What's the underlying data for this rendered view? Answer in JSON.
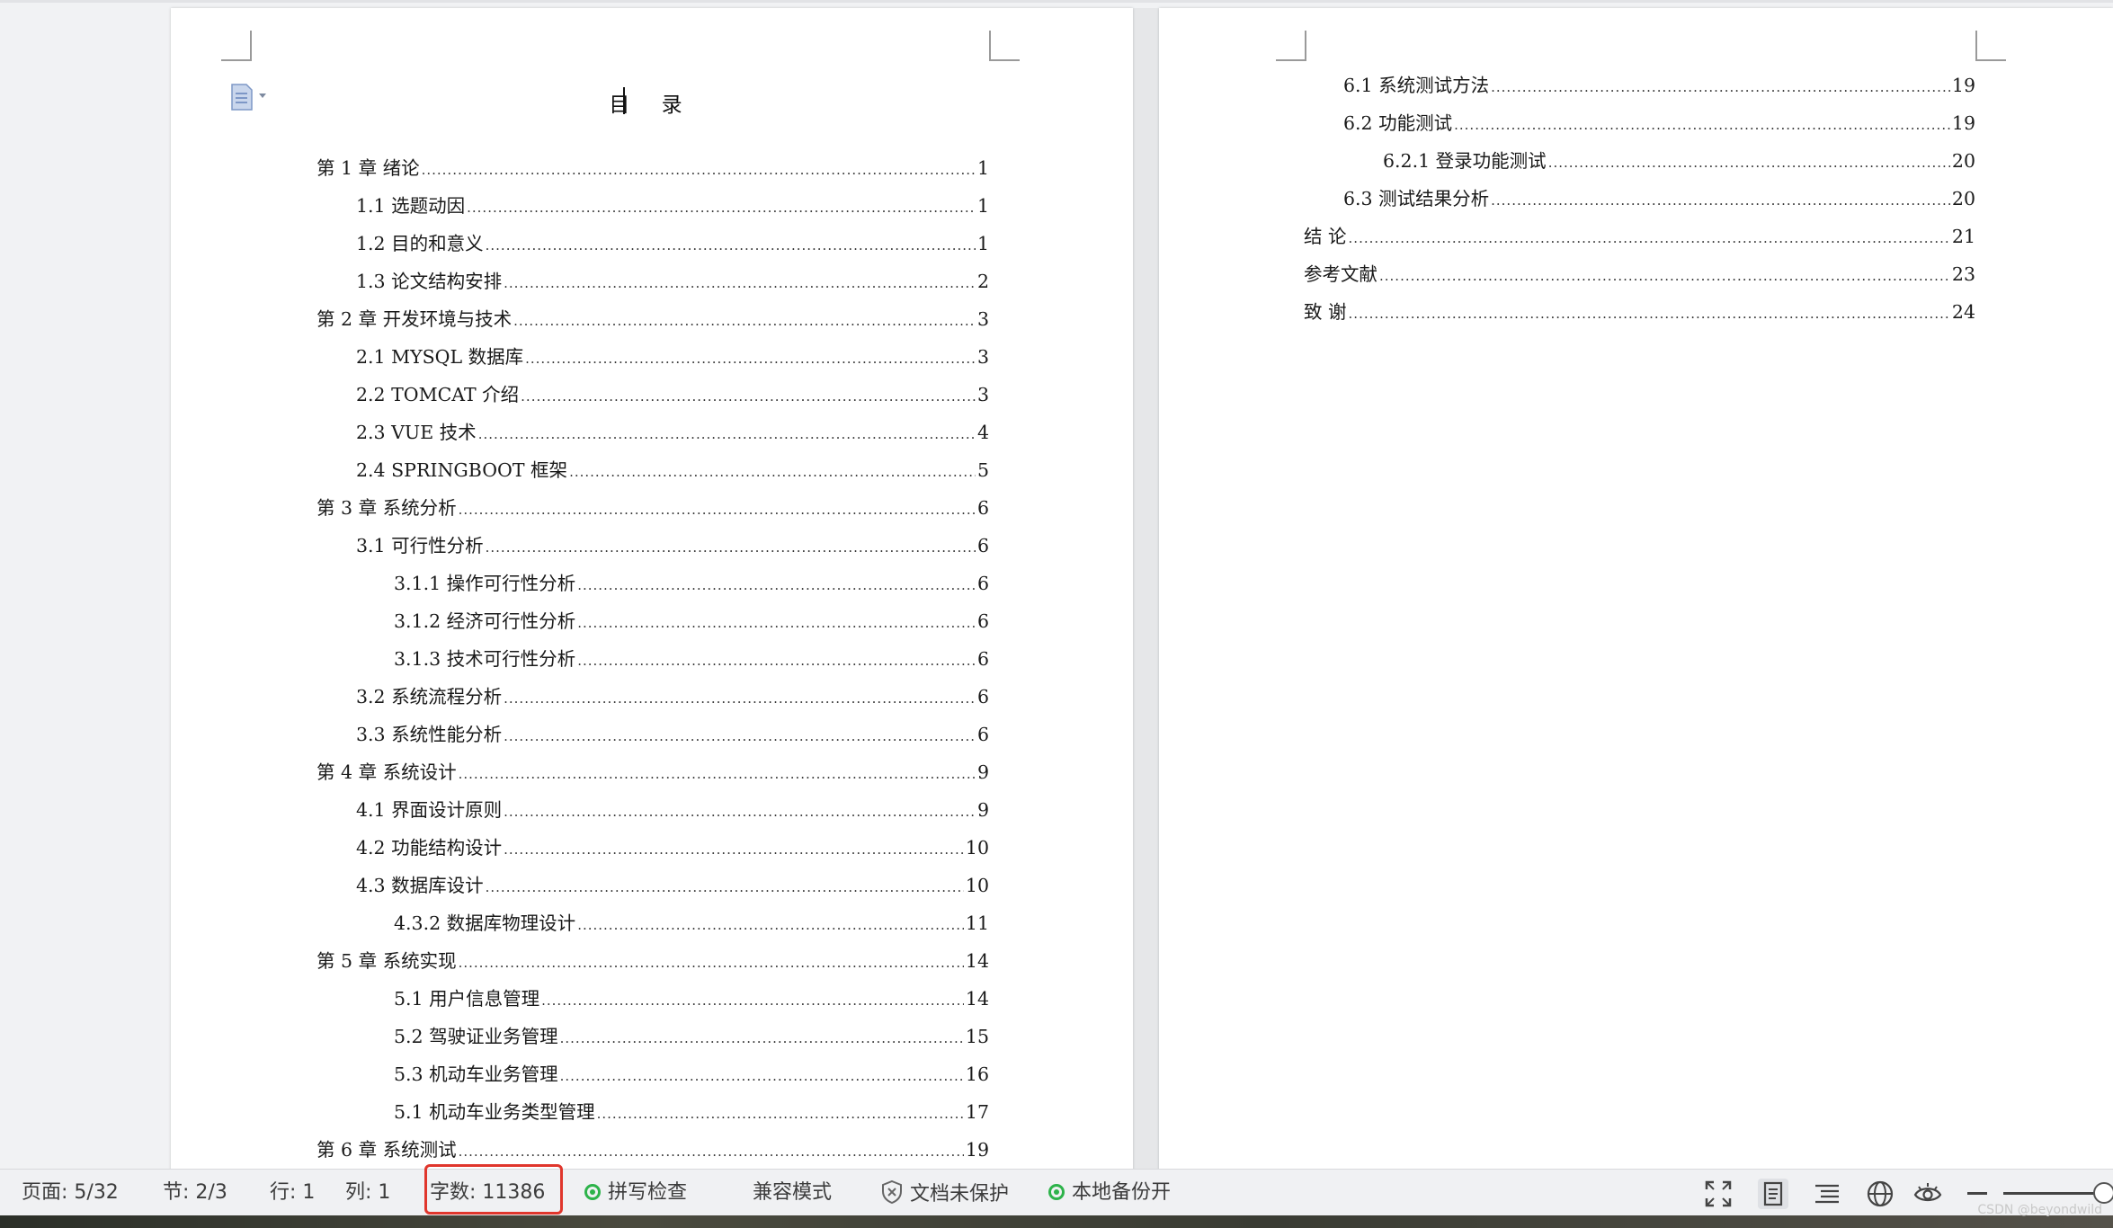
{
  "document": {
    "toc_title": "目  录",
    "left_page_entries": [
      {
        "text": "第 1 章  绪论",
        "page": "1",
        "level": 0
      },
      {
        "text": "1.1 选题动因",
        "page": "1",
        "level": 1
      },
      {
        "text": "1.2 目的和意义",
        "page": "1",
        "level": 1
      },
      {
        "text": "1.3 论文结构安排",
        "page": "2",
        "level": 1
      },
      {
        "text": "第 2 章  开发环境与技术",
        "page": "3",
        "level": 0
      },
      {
        "text": "2.1 MYSQL 数据库",
        "page": "3",
        "level": 1
      },
      {
        "text": "2.2 TOMCAT  介绍",
        "page": "3",
        "level": 1
      },
      {
        "text": "2.3 VUE 技术",
        "page": "4",
        "level": 1
      },
      {
        "text": "2.4 SPRINGBOOT 框架",
        "page": "5",
        "level": 1
      },
      {
        "text": "第 3 章  系统分析",
        "page": "6",
        "level": 0
      },
      {
        "text": "3.1 可行性分析",
        "page": "6",
        "level": 1
      },
      {
        "text": "3.1.1 操作可行性分析",
        "page": "6",
        "level": 2
      },
      {
        "text": "3.1.2 经济可行性分析",
        "page": "6",
        "level": 2
      },
      {
        "text": "3.1.3 技术可行性分析",
        "page": "6",
        "level": 2
      },
      {
        "text": "3.2 系统流程分析",
        "page": "6",
        "level": 1
      },
      {
        "text": "3.3 系统性能分析",
        "page": "6",
        "level": 1
      },
      {
        "text": "第 4 章  系统设计",
        "page": "9",
        "level": 0
      },
      {
        "text": "4.1 界面设计原则",
        "page": "9",
        "level": 1
      },
      {
        "text": "4.2 功能结构设计",
        "page": "10",
        "level": 1
      },
      {
        "text": "4.3 数据库设计",
        "page": "10",
        "level": 1
      },
      {
        "text": "4.3.2  数据库物理设计",
        "page": "11",
        "level": 2
      },
      {
        "text": "第 5 章  系统实现",
        "page": "14",
        "level": 0
      },
      {
        "text": "5.1 用户信息管理",
        "page": "14",
        "level": 2
      },
      {
        "text": "5.2  驾驶证业务管理",
        "page": "15",
        "level": 2
      },
      {
        "text": "5.3 机动车业务管理",
        "page": "16",
        "level": 2
      },
      {
        "text": "5.1 机动车业务类型管理",
        "page": "17",
        "level": 2
      },
      {
        "text": "第 6 章  系统测试",
        "page": "19",
        "level": 0
      }
    ],
    "right_page_entries": [
      {
        "text": "6.1  系统测试方法",
        "page": "19",
        "level": 1
      },
      {
        "text": "6.2  功能测试",
        "page": "19",
        "level": 1
      },
      {
        "text": "6.2.1  登录功能测试",
        "page": "20",
        "level": 2
      },
      {
        "text": "6.3  测试结果分析",
        "page": "20",
        "level": 1
      },
      {
        "text": "结    论",
        "page": "21",
        "level": 0
      },
      {
        "text": "参考文献",
        "page": "23",
        "level": 0
      },
      {
        "text": "致    谢",
        "page": "24",
        "level": 0
      }
    ]
  },
  "statusbar": {
    "page": "页面: 5/32",
    "section": "节: 2/3",
    "row": "行: 1",
    "col": "列: 1",
    "word_count": "字数: 11386",
    "spell_check": "拼写检查",
    "compat_mode": "兼容模式",
    "protection": "文档未保护",
    "local_backup": "本地备份开",
    "icons": [
      "fullscreen-icon",
      "page-view-icon",
      "outline-view-icon",
      "web-view-icon",
      "eye-protection-icon"
    ],
    "accent_color": "#2db34a",
    "highlight_color": "#e0362c"
  },
  "watermark": "CSDN @beyondwild"
}
